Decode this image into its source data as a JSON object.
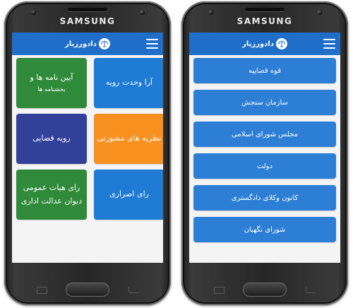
{
  "left_phone": {
    "brand": "SAMSUNG",
    "app_title": "دادورزیار",
    "tiles": [
      {
        "label": "آرا وحدت رویه",
        "sub": "",
        "color": "#1f7bd3"
      },
      {
        "label": "آیین نامه ها و",
        "sub": "بخشنامه ها",
        "color": "#2f8a3a"
      },
      {
        "label": "نظریه های مشورتی",
        "sub": "",
        "color": "#f7901e"
      },
      {
        "label": "رویه قضایی",
        "sub": "",
        "color": "#33409a"
      },
      {
        "label": "رای اصراری",
        "sub": "",
        "color": "#1f7bd3"
      },
      {
        "label": "رای هیات عمومی",
        "sub": "دیوان عدالت اداری",
        "color": "#2f8a3a"
      }
    ]
  },
  "right_phone": {
    "brand": "SAMSUNG",
    "app_title": "دادورزیار",
    "items": [
      {
        "label": "قوه قضاییه"
      },
      {
        "label": "سازمان سنجش"
      },
      {
        "label": "مجلس شورای اسلامی"
      },
      {
        "label": "دولت"
      },
      {
        "label": "کانون وکلای دادگستری"
      },
      {
        "label": "شورای نگهبان"
      }
    ]
  },
  "colors": {
    "appbar": "#1f6ec9",
    "list_button": "#2d7fd6"
  },
  "icons": {
    "menu": "hamburger-icon",
    "logo": "scales-of-justice-icon"
  }
}
